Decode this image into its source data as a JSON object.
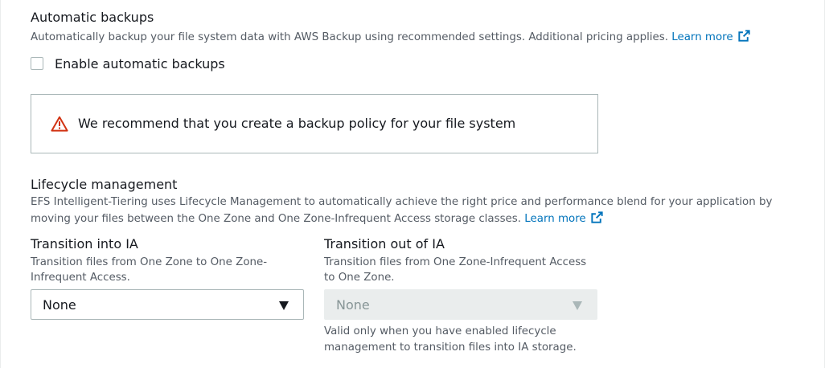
{
  "backups": {
    "title": "Automatic backups",
    "description": "Automatically backup your file system data with AWS Backup using recommended settings. Additional pricing applies.",
    "learn_more": "Learn more",
    "checkbox_label": "Enable automatic backups",
    "checkbox_checked": false
  },
  "alert": {
    "message": "We recommend that you create a backup policy for your file system",
    "icon": "warning-triangle-icon",
    "color": "#d13212"
  },
  "lifecycle": {
    "title": "Lifecycle management",
    "description_line1": "EFS Intelligent-Tiering uses Lifecycle Management to automatically achieve the right price and performance blend for your application by",
    "description_line2": "moving your files between the One Zone and One Zone-Infrequent Access storage classes.",
    "learn_more": "Learn more"
  },
  "transition_into_ia": {
    "label": "Transition into IA",
    "description_line1": "Transition files from One Zone to One Zone-",
    "description_line2": "Infrequent Access.",
    "value": "None"
  },
  "transition_out_of_ia": {
    "label": "Transition out of IA",
    "description_line1": "Transition files from One Zone-Infrequent Access",
    "description_line2": "to One Zone.",
    "value": "None",
    "hint_line1": "Valid only when you have enabled lifecycle",
    "hint_line2": "management to transition files into IA storage."
  },
  "colors": {
    "link": "#0073bb",
    "text": "#16191f",
    "secondary_text": "#545b64",
    "border": "#aab7b8",
    "disabled_bg": "#eaeded"
  }
}
